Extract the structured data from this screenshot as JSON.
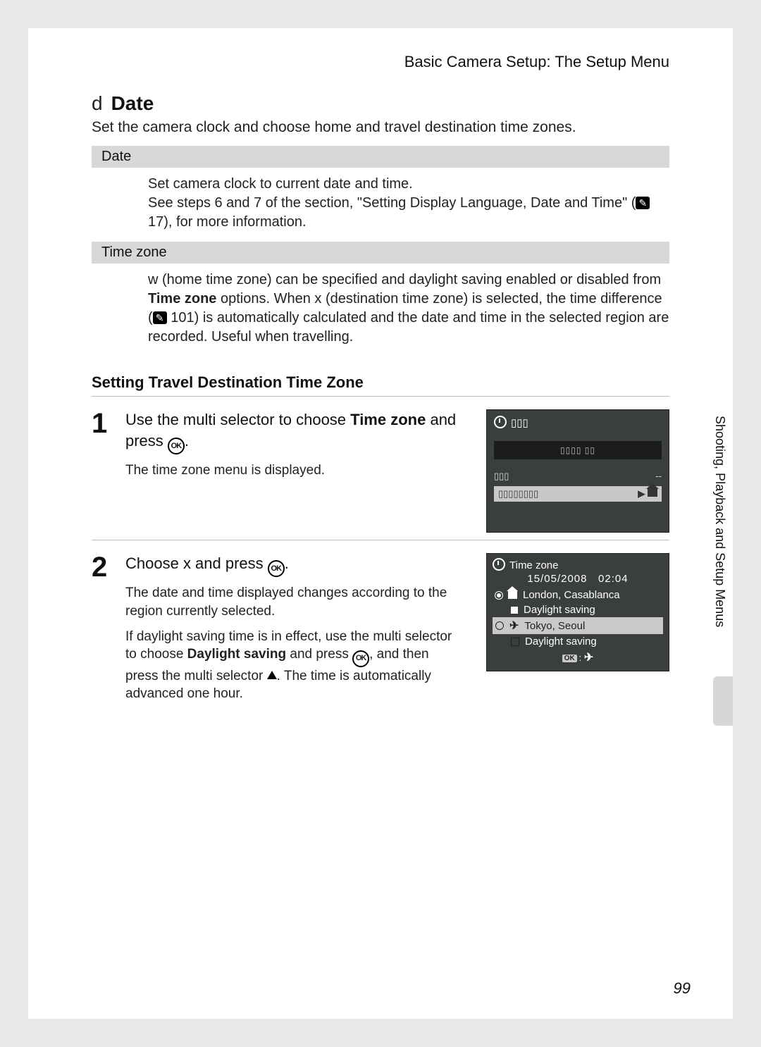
{
  "header": "Basic Camera Setup: The Setup Menu",
  "title_icon": "d",
  "title": "Date",
  "intro": "Set the camera clock and choose home and travel destination time zones.",
  "sections": {
    "date": {
      "label": "Date",
      "body_1": "Set camera clock to current date and time.",
      "body_2a": "See steps 6 and 7 of the section, \"Setting Display Language, Date and Time\" (",
      "body_2_pageref": "17",
      "body_2b": "), for more information."
    },
    "timezone": {
      "label": "Time zone",
      "body_a": "w  (home time zone) can be specified and daylight saving enabled or disabled from ",
      "body_bold": "Time zone",
      "body_b": " options. When x  (destination time zone) is selected, the time difference (",
      "body_pageref": "101",
      "body_c": ") is automatically calculated and the date and time in the selected region are recorded. Useful when travelling."
    }
  },
  "subheading": "Setting Travel Destination Time Zone",
  "steps": {
    "s1": {
      "num": "1",
      "text_a": "Use the multi selector to choose ",
      "text_bold": "Time zone",
      "text_b": " and press ",
      "detail": "The time zone menu is displayed."
    },
    "s2": {
      "num": "2",
      "text_a": "Choose x  and press ",
      "detail_1": "The date and time displayed changes according to the region currently selected.",
      "detail_2a": "If daylight saving time is in effect, use the multi selector to choose ",
      "detail_2_bold": "Daylight saving",
      "detail_2b": " and press ",
      "detail_2c": ", and then press the multi selector ",
      "detail_2d": ". The time is automatically advanced one hour."
    }
  },
  "lcd1": {
    "title_placeholder": "▯▯▯",
    "mid_placeholder": "▯▯▯▯  ▯▯",
    "row3_left": "▯▯▯",
    "row3_right": "--",
    "row4_text": "▯▯▯▯▯▯▯▯"
  },
  "lcd2": {
    "title": "Time zone",
    "date": "15/05/2008",
    "time": "02:04",
    "home": "London, Casablanca",
    "home_ds": "Daylight saving",
    "dest": "Tokyo, Seoul",
    "dest_ds": "Daylight saving",
    "footer_ok": "OK"
  },
  "side_label": "Shooting, Playback and Setup Menus",
  "page_number": "99"
}
